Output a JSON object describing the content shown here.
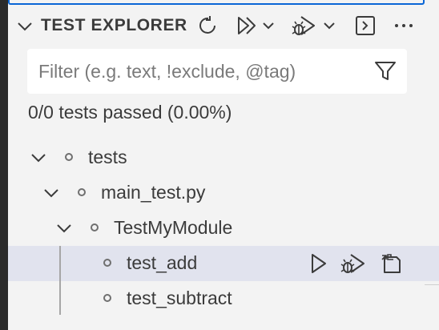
{
  "panel": {
    "title": "TEST EXPLORER",
    "header_icons": [
      "chevron-down-icon",
      "refresh-icon",
      "run-tests-icon",
      "chevron-down-icon",
      "debug-tests-icon",
      "chevron-down-icon",
      "terminal-icon",
      "more-icon"
    ]
  },
  "filter": {
    "placeholder": "Filter (e.g. text, !exclude, @tag)",
    "value": "",
    "icon": "filter-icon"
  },
  "status": {
    "text": "0/0 tests passed (0.00%)"
  },
  "tree": {
    "items": [
      {
        "label": "tests",
        "expanded": true
      },
      {
        "label": "main_test.py",
        "expanded": true
      },
      {
        "label": "TestMyModule",
        "expanded": true
      },
      {
        "label": "test_add",
        "selected": true,
        "actions": [
          "run-test-icon",
          "debug-test-icon",
          "go-to-test-icon"
        ]
      },
      {
        "label": "test_subtract"
      }
    ]
  },
  "colors": {
    "background": "#f3f3f3",
    "selection": "#e1e3ee",
    "focus_border": "#0a66d6",
    "text": "#3b3b3b"
  }
}
